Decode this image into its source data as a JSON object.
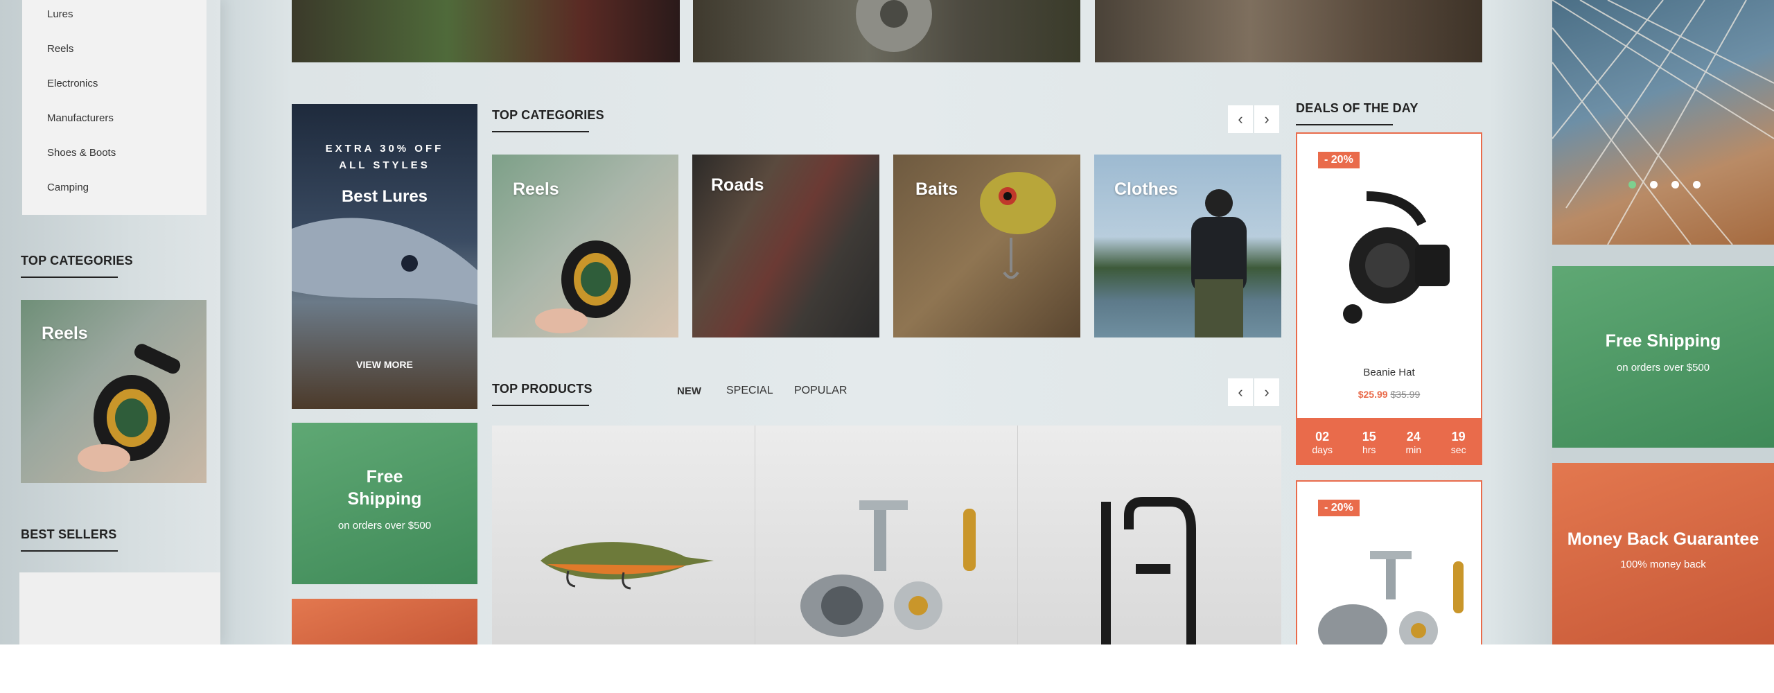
{
  "sidebar": {
    "categories": [
      "Lures",
      "Reels",
      "Electronics",
      "Manufacturers",
      "Shoes & Boots",
      "Camping"
    ],
    "top_categories_title": "TOP CATEGORIES",
    "featured_tile_label": "Reels",
    "best_sellers_title": "BEST SELLERS"
  },
  "promo_lures": {
    "line1": "EXTRA 30% OFF",
    "line2": "ALL STYLES",
    "title": "Best Lures",
    "button": "VIEW MORE"
  },
  "promo_shipping_small": {
    "title_line1": "Free",
    "title_line2": "Shipping",
    "subtitle": "on orders over $500"
  },
  "top_categories": {
    "title": "TOP CATEGORIES",
    "prev_icon": "chevron-left-icon",
    "next_icon": "chevron-right-icon",
    "items": [
      {
        "label": "Reels"
      },
      {
        "label": "Roads"
      },
      {
        "label": "Baits"
      },
      {
        "label": "Clothes"
      }
    ]
  },
  "top_products": {
    "title": "TOP PRODUCTS",
    "tabs": [
      "NEW",
      "SPECIAL",
      "POPULAR"
    ],
    "active_tab": "NEW"
  },
  "deals": {
    "title": "DEALS OF THE DAY",
    "cards": [
      {
        "badge": "- 20%",
        "name": "Beanie Hat",
        "price": "$25.99",
        "old_price": "$35.99",
        "timer": [
          {
            "num": "02",
            "unit": "days"
          },
          {
            "num": "15",
            "unit": "hrs"
          },
          {
            "num": "24",
            "unit": "min"
          },
          {
            "num": "19",
            "unit": "sec"
          }
        ]
      },
      {
        "badge": "- 20%"
      }
    ]
  },
  "right_promos": {
    "shipping_title": "Free Shipping",
    "shipping_sub": "on orders over $500",
    "money_title": "Money Back Guarantee",
    "money_sub": "100% money back",
    "slider_dots": 4,
    "active_dot": 0
  },
  "colors": {
    "accent": "#e96b4b",
    "green_promo": "#4e9a63",
    "orange_promo": "#d2643f",
    "active_dot": "#7ed08f"
  }
}
